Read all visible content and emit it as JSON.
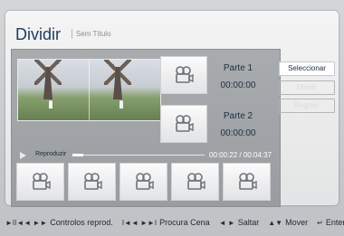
{
  "header": {
    "title": "Dividir",
    "subtitle": "Sem Título"
  },
  "parts": [
    {
      "label": "Parte 1",
      "time": "00:00:00"
    },
    {
      "label": "Parte 2",
      "time": "00:00:00"
    }
  ],
  "buttons": {
    "select": "Seleccionar",
    "split": "Dividir",
    "back": "Regres."
  },
  "player": {
    "play_label": "Reproduzir",
    "time": "00:00:22 / 00:04:37",
    "progress_fraction": 0.08
  },
  "icons": {
    "thumbnail": "film-camera-icon"
  },
  "thumbnails_count": 5,
  "bottom_hints": [
    {
      "symbol": "►II◄◄ ►►",
      "label": "Controlos reprod."
    },
    {
      "symbol": "I◄◄ ►►I",
      "label": "Procura Cena"
    },
    {
      "symbol": "◄ ►",
      "label": "Saltar"
    },
    {
      "symbol": "▲▼",
      "label": "Mover"
    },
    {
      "symbol": "↵",
      "label": "Enter"
    }
  ],
  "colors": {
    "title": "#1f3a5c",
    "panel": "#a3a6a9",
    "text_dark": "#1d2d3f"
  }
}
